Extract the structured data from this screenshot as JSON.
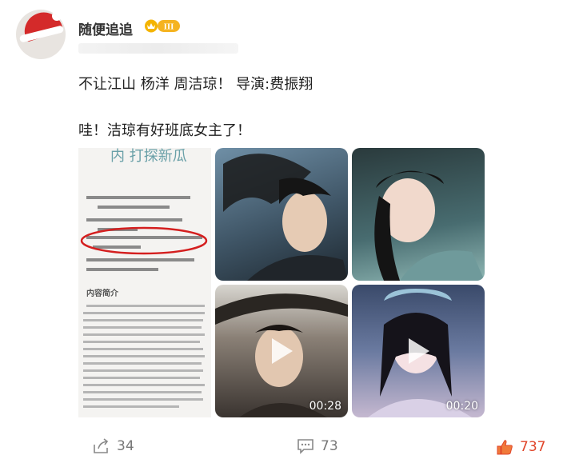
{
  "user": {
    "name": "随便追追",
    "level": "III"
  },
  "post": {
    "line1": "不让江山 杨洋 周洁琼！ 导演:费振翔",
    "line2": "哇！洁琼有好班底女主了！"
  },
  "media": {
    "doc_title_fragment": "内  打探新瓜",
    "doc_heading": "内容简介",
    "videos": [
      {
        "duration": "00:28"
      },
      {
        "duration": "00:20"
      }
    ]
  },
  "actions": {
    "share_count": "34",
    "comment_count": "73",
    "like_count": "737"
  },
  "colors": {
    "accent_red": "#e0452a",
    "text_gray": "#777777",
    "circle_red": "#d41f1f"
  }
}
